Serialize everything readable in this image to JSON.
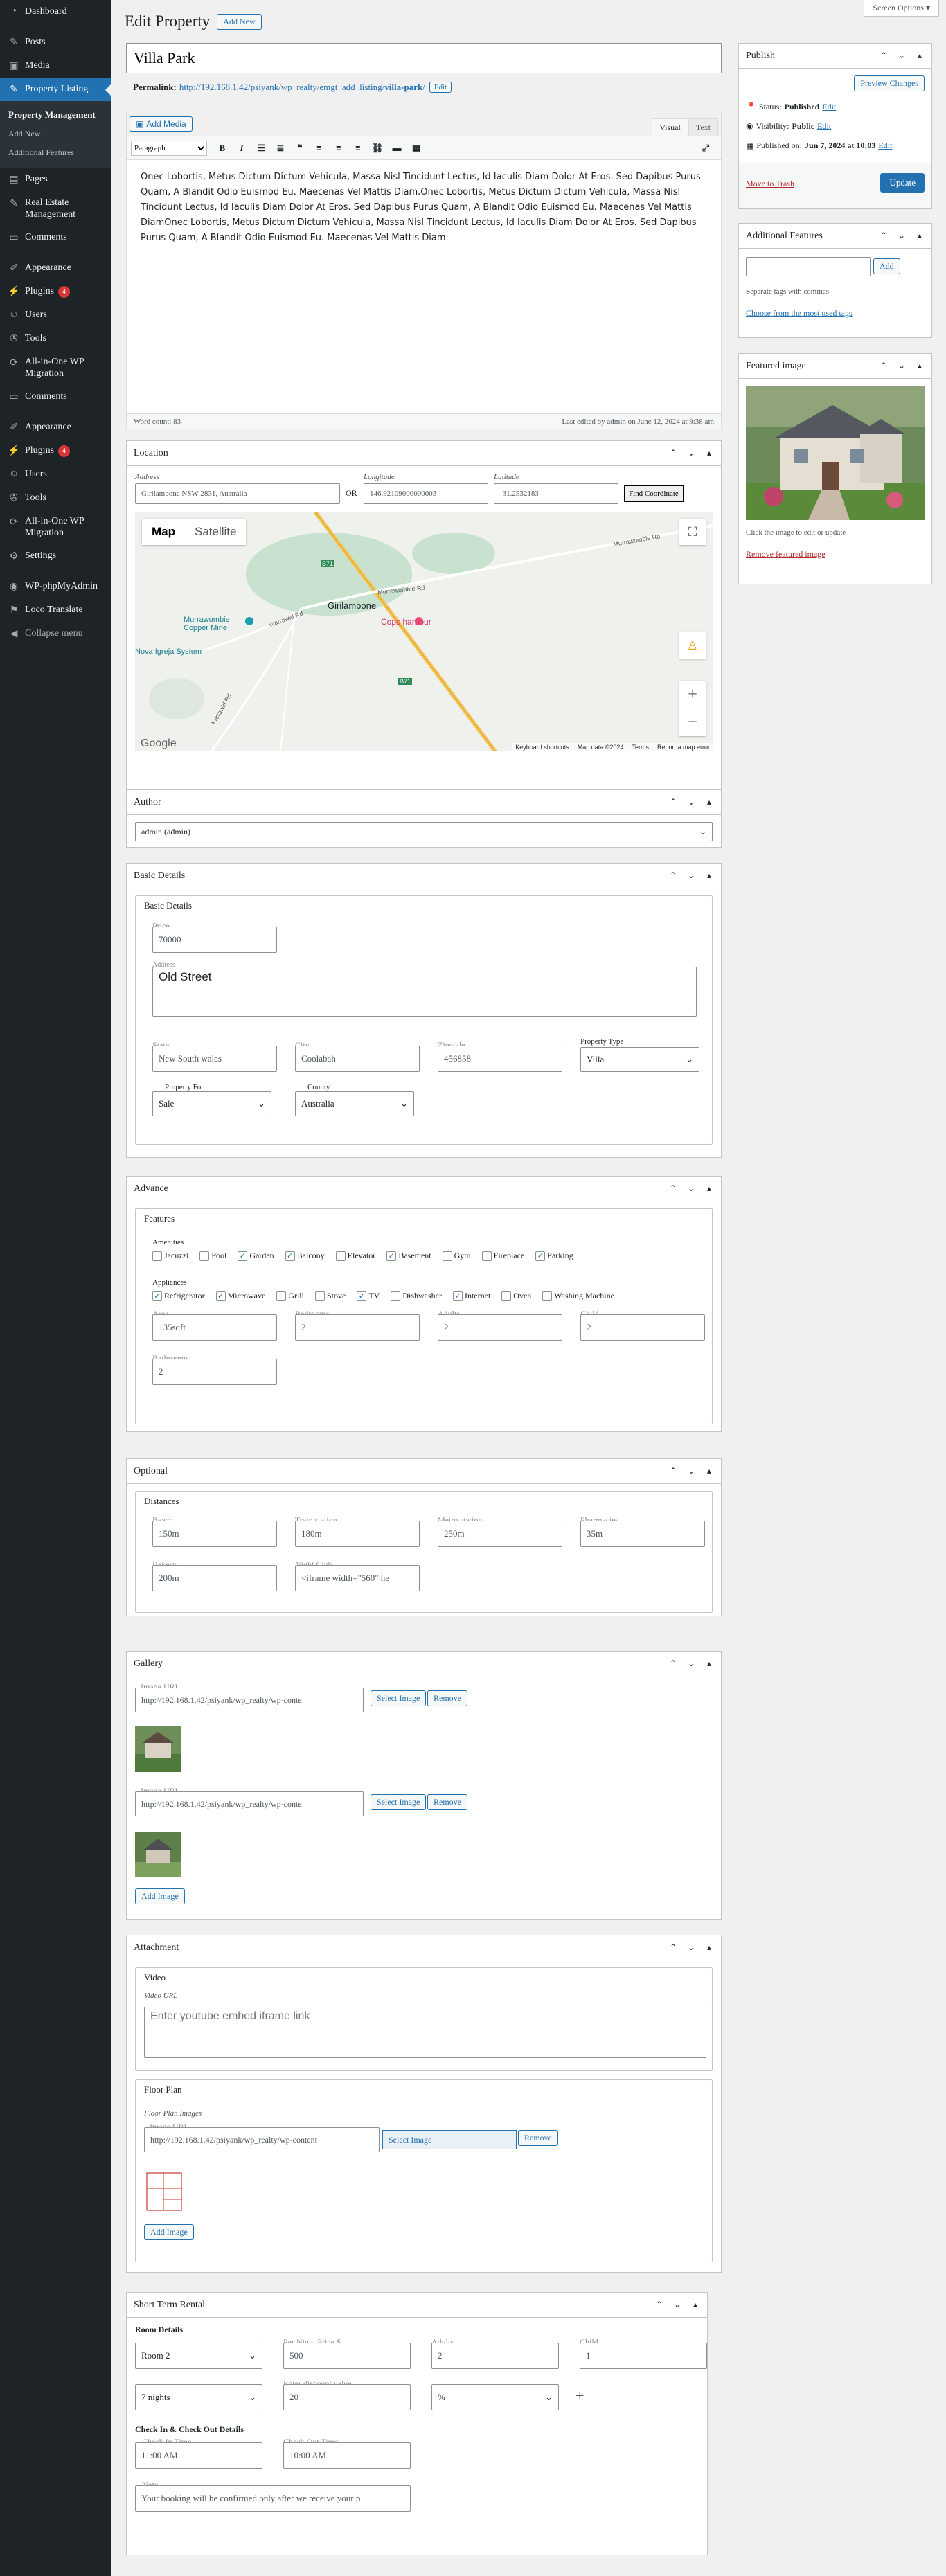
{
  "sidebar": {
    "items": [
      {
        "label": "Dashboard",
        "icon": "dashboard-icon"
      },
      {
        "label": "Posts",
        "icon": "pin-icon"
      },
      {
        "label": "Media",
        "icon": "media-icon"
      },
      {
        "label": "Property Listing",
        "icon": "pin-icon"
      },
      {
        "label": "Pages",
        "icon": "page-icon"
      },
      {
        "label": "Real Estate Management",
        "icon": "pin-icon"
      },
      {
        "label": "Comments",
        "icon": "comment-icon"
      },
      {
        "label": "Appearance",
        "icon": "brush-icon"
      },
      {
        "label": "Plugins",
        "icon": "plug-icon",
        "badge": "4"
      },
      {
        "label": "Users",
        "icon": "users-icon"
      },
      {
        "label": "Tools",
        "icon": "wrench-icon"
      },
      {
        "label": "All-in-One WP Migration",
        "icon": "migration-icon"
      },
      {
        "label": "Comments",
        "icon": "comment-icon"
      },
      {
        "label": "Appearance",
        "icon": "brush-icon"
      },
      {
        "label": "Plugins",
        "icon": "plug-icon",
        "badge": "4"
      },
      {
        "label": "Users",
        "icon": "users-icon"
      },
      {
        "label": "Tools",
        "icon": "wrench-icon"
      },
      {
        "label": "All-in-One WP Migration",
        "icon": "migration-icon"
      },
      {
        "label": "Settings",
        "icon": "settings-icon"
      },
      {
        "label": "WP-phpMyAdmin",
        "icon": "database-icon"
      },
      {
        "label": "Loco Translate",
        "icon": "translate-icon"
      },
      {
        "label": "Collapse menu",
        "icon": "collapse-icon"
      }
    ],
    "submenu": [
      "Property Management",
      "Add New",
      "Additional Features"
    ]
  },
  "header": {
    "title": "Edit Property",
    "add_new": "Add New",
    "screen_options": "Screen Options ▾"
  },
  "post": {
    "title": "Villa Park",
    "permalink_label": "Permalink:",
    "permalink_base": "http://192.168.1.42/psiyank/wp_realty/emgt_add_listing/",
    "permalink_slug": "villa-park",
    "permalink_suffix": "/",
    "edit": "Edit"
  },
  "editor": {
    "add_media": "Add Media",
    "tab_visual": "Visual",
    "tab_text": "Text",
    "format": "Paragraph",
    "content": "Onec Lobortis, Metus Dictum Dictum Vehicula, Massa Nisl Tincidunt Lectus, Id Iaculis Diam Dolor At Eros. Sed Dapibus Purus Quam, A Blandit Odio Euismod Eu. Maecenas Vel Mattis Diam.Onec Lobortis, Metus Dictum Dictum Vehicula, Massa Nisl Tincidunt Lectus, Id Iaculis Diam Dolor At Eros. Sed Dapibus Purus Quam, A Blandit Odio Euismod Eu. Maecenas Vel Mattis DiamOnec Lobortis, Metus Dictum Dictum Vehicula, Massa Nisl Tincidunt Lectus, Id Iaculis Diam Dolor At Eros. Sed Dapibus Purus Quam, A Blandit Odio Euismod Eu. Maecenas Vel Mattis Diam",
    "word_count": "Word count: 83",
    "last_edited": "Last edited by admin on June 12, 2024 at 9:38 am"
  },
  "location": {
    "title": "Location",
    "address_label": "Address",
    "address": "Girilambone NSW 2831, Australia",
    "or": "OR",
    "longitude_label": "Longitude",
    "longitude": "146.92109000000003",
    "latitude_label": "Latitude",
    "latitude": "-31.2532183",
    "find_button": "Find Coordinate",
    "map_tab": "Map",
    "satellite_tab": "Satellite",
    "places": [
      "Girilambone",
      "Cops harbour",
      "Murrawombie Copper Mine",
      "Nova Igreja System",
      "Murrawombie Rd",
      "Murrawombie Rd",
      "Warrawid Rd",
      "Karrawid Rd"
    ],
    "google": "Google",
    "attrib": [
      "Keyboard shortcuts",
      "Map data ©2024",
      "Terms",
      "Report a map error"
    ],
    "road_labels": [
      "B71",
      "B71"
    ]
  },
  "author": {
    "title": "Author",
    "value": "admin (admin)"
  },
  "basic": {
    "title": "Basic Details",
    "legend": "Basic Details",
    "price_label": "Price",
    "price": "70000",
    "address_label": "Address",
    "address": "Old Street",
    "state_label": "State",
    "state": "New South wales",
    "city_label": "City",
    "city": "Coolabah",
    "zip_label": "Zipcode",
    "zip": "456858",
    "type_label": "Property Type",
    "type": "Villa",
    "for_label": "Property For",
    "for": "Sale",
    "country_label": "County",
    "country": "Australia"
  },
  "advance": {
    "title": "Advance",
    "legend": "Features",
    "amenities_label": "Amenities",
    "amenities": [
      {
        "label": "Jacuzzi",
        "checked": false
      },
      {
        "label": "Pool",
        "checked": false
      },
      {
        "label": "Garden",
        "checked": true
      },
      {
        "label": "Balcony",
        "checked": true
      },
      {
        "label": "Elevator",
        "checked": false
      },
      {
        "label": "Basement",
        "checked": true
      },
      {
        "label": "Gym",
        "checked": false
      },
      {
        "label": "Fireplace",
        "checked": false
      },
      {
        "label": "Parking",
        "checked": true
      }
    ],
    "appliances_label": "Appliances",
    "appliances": [
      {
        "label": "Refrigerator",
        "checked": true
      },
      {
        "label": "Microwave",
        "checked": true
      },
      {
        "label": "Grill",
        "checked": false
      },
      {
        "label": "Stove",
        "checked": false
      },
      {
        "label": "TV",
        "checked": true
      },
      {
        "label": "Dishwasher",
        "checked": false
      },
      {
        "label": "Internet",
        "checked": true
      },
      {
        "label": "Oven",
        "checked": false
      },
      {
        "label": "Washing Machine",
        "checked": false
      }
    ],
    "area_label": "Area",
    "area": "135sqft",
    "bedrooms_label": "Bedrooms",
    "bedrooms": "2",
    "adults_label": "Adults",
    "adults": "2",
    "child_label": "Child",
    "child": "2",
    "bathrooms_label": "Bathrooms",
    "bathrooms": "2"
  },
  "optional": {
    "title": "Optional",
    "legend": "Distances",
    "beach_label": "Beach",
    "beach": "150m",
    "train_label": "Train station",
    "train": "180m",
    "metro_label": "Metro station",
    "metro": "250m",
    "pharm_label": "Pharmacies",
    "pharm": "35m",
    "bakery_label": "Bakery",
    "bakery": "200m",
    "club_label": "Night Club",
    "club": "<iframe width=\"560\" he"
  },
  "gallery": {
    "title": "Gallery",
    "image_url_label": "Image URL",
    "url": "http://192.168.1.42/psiyank/wp_realty/wp-conte",
    "select": "Select Image",
    "remove": "Remove",
    "add": "Add Image"
  },
  "attachment": {
    "title": "Attachment",
    "video_legend": "Video",
    "video_label": "Video URL",
    "video_placeholder": "Enter youtube embed iframe link",
    "floor_legend": "Floor Plan",
    "floor_images_label": "Floor Plan Images",
    "image_url_label": "Image URL",
    "floor_url": "http://192.168.1.42/psiyank/wp_realty/wp-content",
    "select": "Select Image",
    "remove": "Remove",
    "add": "Add Image"
  },
  "rental": {
    "title": "Short Term Rental",
    "room_details": "Room Details",
    "room": "Room 2",
    "price_label": "Per Night Price $",
    "price": "500",
    "adults_label": "Adults",
    "adults": "2",
    "child_label": "Child",
    "child": "1",
    "nights": "7 nights",
    "discount_label": "Enter discount value",
    "discount": "20",
    "discount_type": "%",
    "plus": "+",
    "check_details": "Check In & Check Out Details",
    "checkin_label": "Check In Time",
    "checkin": "11:00 AM",
    "checkout_label": "Check Out Time",
    "checkout": "10:00 AM",
    "note_label": "Note",
    "note": "Your booking will be confirmed only after we receive your p"
  },
  "publish": {
    "title": "Publish",
    "preview": "Preview Changes",
    "status_label": "Status:",
    "status": "Published",
    "visibility_label": "Visibility:",
    "visibility": "Public",
    "published_label": "Published on:",
    "published": "Jun 7, 2024 at 10:03",
    "edit": "Edit",
    "trash": "Move to Trash",
    "update": "Update"
  },
  "features": {
    "title": "Additional Features",
    "add": "Add",
    "hint": "Separate tags with commas",
    "choose": "Choose from the most used tags"
  },
  "featured": {
    "title": "Featured image",
    "hint": "Click the image to edit or update",
    "remove": "Remove featured image"
  },
  "colors": {
    "accent": "#2271b1",
    "sidebar": "#1d2327",
    "danger": "#d63638"
  }
}
